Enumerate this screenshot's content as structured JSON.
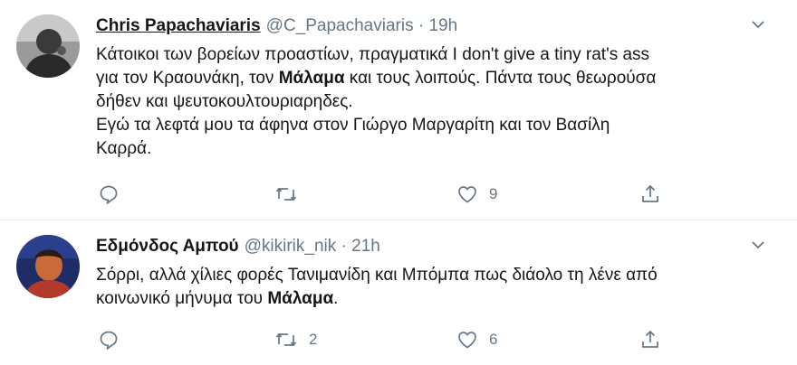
{
  "tweets": [
    {
      "name": "Chris Papachaviaris",
      "handle": "@C_Papachaviaris",
      "separator": "·",
      "time": "19h",
      "lines": [
        [
          "Κάτοικοι των βορείων προαστίων, πραγματικά I don't give a tiny rat's ass"
        ],
        [
          "για τον Κραουνάκη, τον ",
          "Μάλαμα",
          " και τους λοιπούς. Πάντα τους θεωρούσα"
        ],
        [
          "δήθεν και ψευτοκουλτουριαρηδες."
        ],
        [
          "Εγώ τα λεφτά μου τα άφηνα στον Γιώργο Μαργαρίτη και τον Βασίλη"
        ],
        [
          "Καρρά."
        ]
      ],
      "reply_count": "",
      "retweet_count": "",
      "like_count": "9"
    },
    {
      "name": "Εδμόνδος Αμπού",
      "handle": "@kikirik_nik",
      "separator": "·",
      "time": "21h",
      "lines": [
        [
          "Σόρρι, αλλά χίλιες φορές Τανιμανίδη και Μπόμπα πως διάολο τη λένε από"
        ],
        [
          "κοινωνικό μήνυμα του ",
          "Μάλαμα",
          "."
        ]
      ],
      "reply_count": "",
      "retweet_count": "2",
      "like_count": "6"
    }
  ],
  "colors": {
    "secondary": "#657786",
    "text": "#14171a",
    "divider": "#e6ecf0"
  },
  "icons": [
    "reply-icon",
    "retweet-icon",
    "like-icon",
    "share-icon",
    "chevron-down-icon"
  ]
}
